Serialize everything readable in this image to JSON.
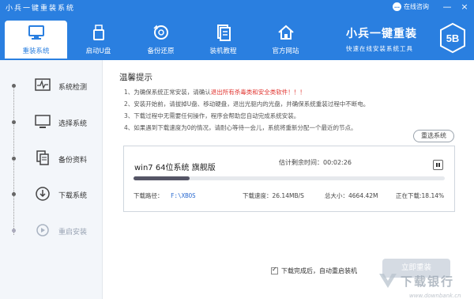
{
  "window": {
    "title": "小兵一键重装系统",
    "online_help": "在线咨询",
    "minimize": "—",
    "close": "×"
  },
  "nav": {
    "items": [
      {
        "label": "重装系统",
        "icon": "monitor-icon",
        "active": true
      },
      {
        "label": "启动U盘",
        "icon": "usb-icon",
        "active": false
      },
      {
        "label": "备份还原",
        "icon": "restore-icon",
        "active": false
      },
      {
        "label": "装机教程",
        "icon": "document-icon",
        "active": false
      },
      {
        "label": "官方网站",
        "icon": "home-icon",
        "active": false
      }
    ]
  },
  "brand": {
    "name": "小兵一键重装",
    "slogan": "快速在线安装系统工具",
    "logo_text": "5B"
  },
  "steps": [
    {
      "label": "系统检测",
      "icon": "pulse-icon",
      "state": "done"
    },
    {
      "label": "选择系统",
      "icon": "monitor-icon",
      "state": "done"
    },
    {
      "label": "备份资料",
      "icon": "files-icon",
      "state": "done"
    },
    {
      "label": "下载系统",
      "icon": "download-icon",
      "state": "active"
    },
    {
      "label": "重启安装",
      "icon": "restart-icon",
      "state": "disabled"
    }
  ],
  "main": {
    "title": "温馨提示",
    "notes": {
      "n1_prefix": "1、为确保系统正常安装，请确认",
      "n1_red": "退出所有杀毒类和安全类软件！！！",
      "n2": "2、安装开始前，请拔掉U盘、移动硬盘，退出光驱内的光盘，并确保系统重装过程中不断电。",
      "n3": "3、下载过程中无需要任何操作，程序会帮助您自动完成系统安装。",
      "n4": "4、如果遇到下载速度为0的情况，请耐心等待一会儿，系统将重新分配一个最近的节点。"
    },
    "reselect_button": "重选系统"
  },
  "task": {
    "os_name": "win7 64位系统 旗舰版",
    "remaining_label": "估计剩余时间：",
    "remaining_value": "00:02:26",
    "progress_percent": 18.14,
    "path_label": "下载路径：",
    "path_value": "F:\\XBOS",
    "speed_label": "下载速度：",
    "speed_value": "26.14MB/S",
    "size_label": "总大小：",
    "size_value": "4664.42M",
    "status_text": "正在下载:18.14%"
  },
  "footer": {
    "auto_restart_label": "下载完成后，自动重启装机",
    "auto_restart_checked": true,
    "install_button": "立即重装"
  },
  "watermark": {
    "text": "下载银行",
    "url": "www.downbank.cn"
  }
}
